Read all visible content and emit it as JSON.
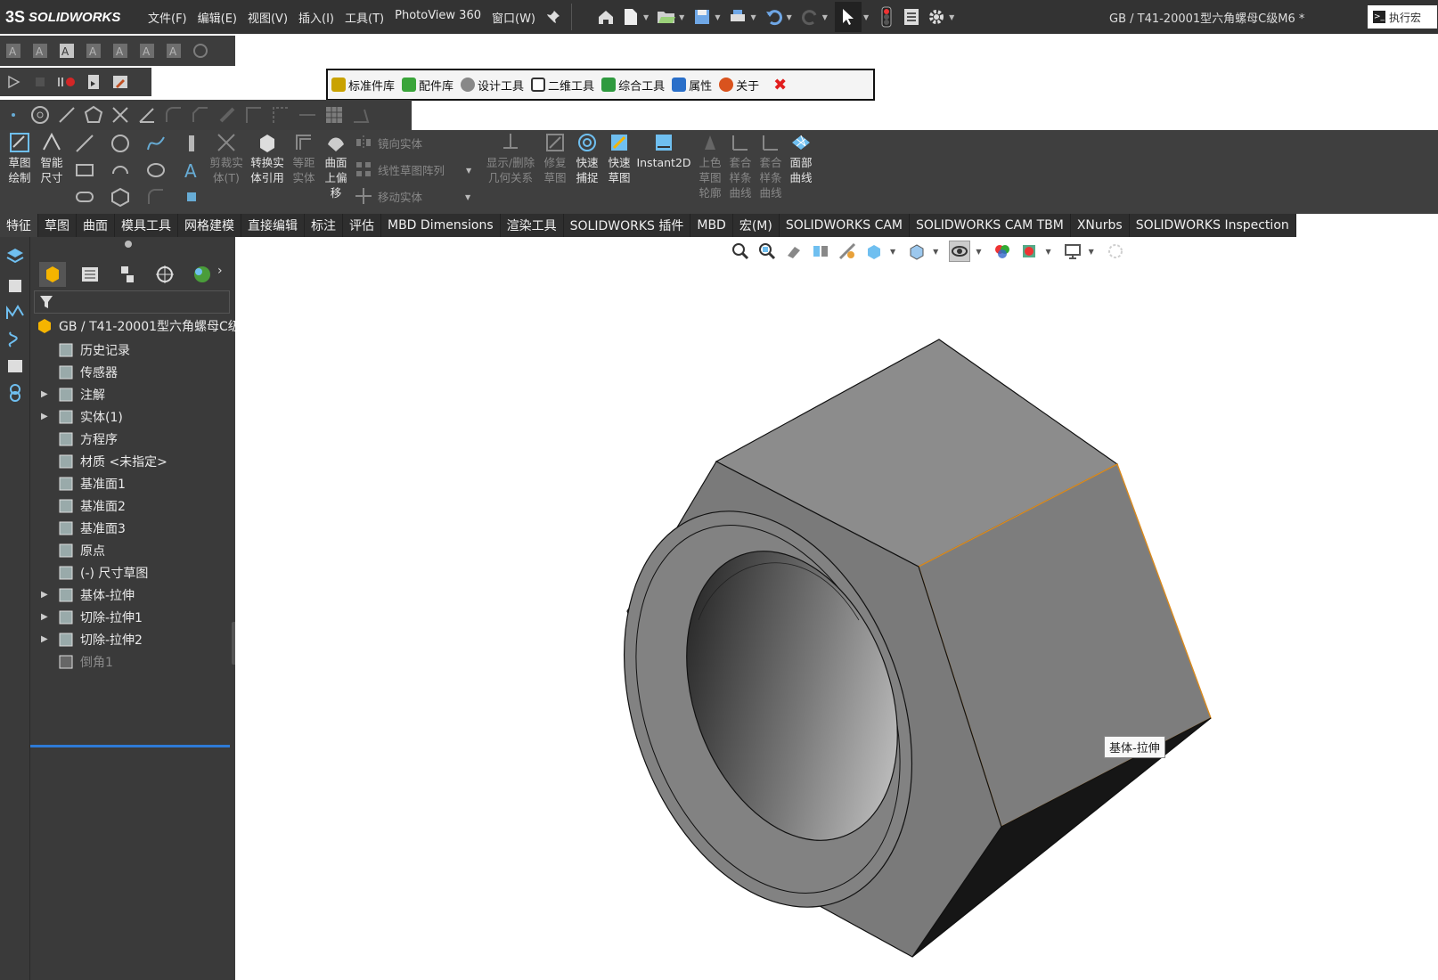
{
  "app": {
    "logo_text": "SOLIDWORKS",
    "logo_prefix": "3S",
    "doc_title": "GB / T41-20001型六角螺母C级M6 *",
    "exec_macro_label": "执行宏"
  },
  "menu": [
    "文件(F)",
    "编辑(E)",
    "视图(V)",
    "插入(I)",
    "工具(T)",
    "PhotoView 360",
    "窗口(W)"
  ],
  "plugin_bar": {
    "items": [
      {
        "label": "标准件库",
        "color": "#c9a200"
      },
      {
        "label": "配件库",
        "color": "#3aa53a"
      },
      {
        "label": "设计工具",
        "color": "#777777"
      },
      {
        "label": "二维工具",
        "color": "#333333"
      },
      {
        "label": "综合工具",
        "color": "#2f9a3f"
      },
      {
        "label": "属性",
        "color": "#2a6fc9"
      },
      {
        "label": "关于",
        "color": "#d9531e"
      }
    ],
    "close_label": "✖"
  },
  "command_manager": {
    "sketch_draw": "草图\n绘制",
    "smart_dim": "智能\n尺寸",
    "trim": "剪裁实\n体(T)",
    "convert": "转换实\n体引用",
    "offset": "等距\n实体",
    "surface_offset": "曲面\n上偏\n移",
    "mirror": "镜向实体",
    "linear_pattern": "线性草图阵列",
    "move": "移动实体",
    "relations": "显示/删除\n几何关系",
    "repair": "修复\n草图",
    "quick_snap": "快速\n捕捉",
    "rapid_sketch": "快速\n草图",
    "instant2d": "Instant2D",
    "shaded_contour": "上色\n草图\n轮廓",
    "fit_spline1": "套合\n样条\n曲线",
    "fit_spline2": "套合\n样条\n曲线",
    "face_curves": "面部\n曲线"
  },
  "tabs": [
    "特征",
    "草图",
    "曲面",
    "模具工具",
    "网格建模",
    "直接编辑",
    "标注",
    "评估",
    "MBD Dimensions",
    "渲染工具",
    "SOLIDWORKS 插件",
    "MBD",
    "宏(M)",
    "SOLIDWORKS CAM",
    "SOLIDWORKS CAM TBM",
    "XNurbs",
    "SOLIDWORKS Inspection"
  ],
  "active_tab": "特征",
  "tree": {
    "root": "GB / T41-20001型六角螺母C级",
    "items": [
      {
        "label": "历史记录",
        "expandable": false,
        "dim": false
      },
      {
        "label": "传感器",
        "expandable": false,
        "dim": false
      },
      {
        "label": "注解",
        "expandable": true,
        "dim": false
      },
      {
        "label": "实体(1)",
        "expandable": true,
        "dim": false
      },
      {
        "label": "方程序",
        "expandable": false,
        "dim": false
      },
      {
        "label": "材质 <未指定>",
        "expandable": false,
        "dim": false
      },
      {
        "label": "基准面1",
        "expandable": false,
        "dim": false
      },
      {
        "label": "基准面2",
        "expandable": false,
        "dim": false
      },
      {
        "label": "基准面3",
        "expandable": false,
        "dim": false
      },
      {
        "label": "原点",
        "expandable": false,
        "dim": false
      },
      {
        "label": "(-) 尺寸草图",
        "expandable": false,
        "dim": false
      },
      {
        "label": "基体-拉伸",
        "expandable": true,
        "dim": false
      },
      {
        "label": "切除-拉伸1",
        "expandable": true,
        "dim": false
      },
      {
        "label": "切除-拉伸2",
        "expandable": true,
        "dim": false
      },
      {
        "label": "倒角1",
        "expandable": false,
        "dim": true
      }
    ]
  },
  "viewport": {
    "tooltip": "基体-拉伸"
  },
  "colors": {
    "ui_dark": "#3a3a3a",
    "selection_edge": "#d98a1e",
    "rollback_bar": "#2e7ad6"
  }
}
